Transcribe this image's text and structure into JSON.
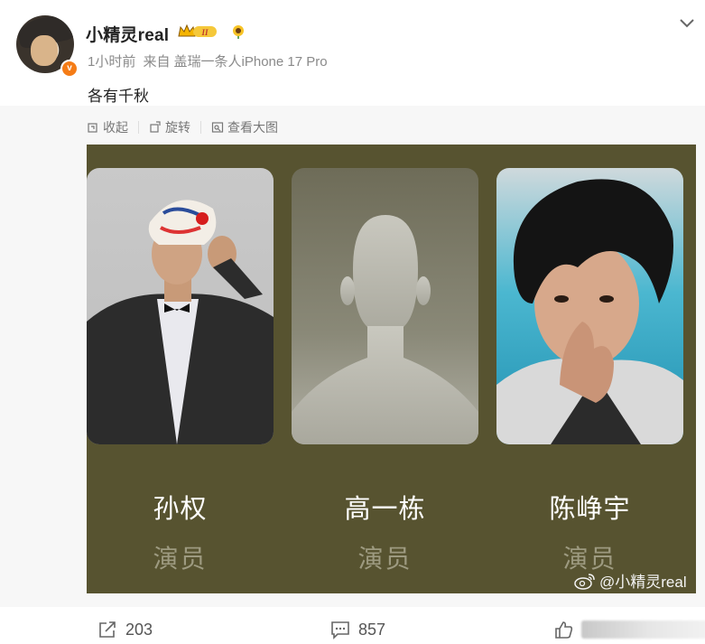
{
  "post": {
    "username": "小精灵real",
    "vip_level": "II",
    "time": "1小时前",
    "source_prefix": "来自",
    "source": "盖瑞一条人iPhone 17 Pro",
    "text": "各有千秋"
  },
  "toolbar": {
    "collapse": "收起",
    "rotate": "旋转",
    "view_large": "查看大图"
  },
  "figure": {
    "people": [
      {
        "name": "孙权",
        "role": "演员"
      },
      {
        "name": "高一栋",
        "role": "演员"
      },
      {
        "name": "陈峥宇",
        "role": "演员"
      }
    ],
    "watermark": "@小精灵real",
    "background_color": "#575330"
  },
  "actions": {
    "repost_count": "203",
    "comment_count": "857"
  },
  "colors": {
    "accent_orange": "#f57c16",
    "meta_gray": "#8a8a8a"
  }
}
